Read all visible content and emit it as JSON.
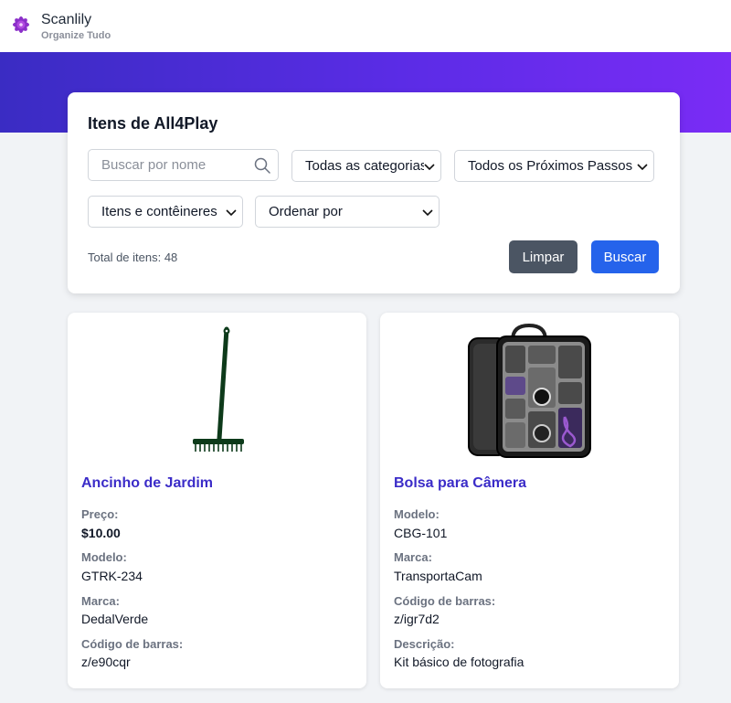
{
  "header": {
    "brand_name": "Scanlily",
    "tagline": "Organize Tudo"
  },
  "filters": {
    "title": "Itens de All4Play",
    "search_placeholder": "Buscar por nome",
    "category_select": "Todas as categorias",
    "next_steps_select": "Todos os Próximos Passos",
    "item_type_select": "Itens e contêineres",
    "sort_select": "Ordenar por",
    "total_label": "Total de itens: 48",
    "clear_label": "Limpar",
    "search_label": "Buscar"
  },
  "items": [
    {
      "title": "Ancinho de Jardim",
      "image_icon": "rake-icon",
      "fields": [
        {
          "label": "Preço:",
          "value": "$10.00"
        },
        {
          "label": "Modelo:",
          "value": "GTRK-234"
        },
        {
          "label": "Marca:",
          "value": "DedalVerde"
        },
        {
          "label": "Código de barras:",
          "value": "z/e90cqr"
        }
      ]
    },
    {
      "title": "Bolsa para Câmera",
      "image_icon": "camera-bag-icon",
      "fields": [
        {
          "label": "Modelo:",
          "value": "CBG-101"
        },
        {
          "label": "Marca:",
          "value": "TransportaCam"
        },
        {
          "label": "Código de barras:",
          "value": "z/igr7d2"
        },
        {
          "label": "Descrição:",
          "value": "Kit básico de fotografia"
        }
      ]
    }
  ],
  "colors": {
    "accent": "#3b2cc8",
    "primary_button": "#2563eb",
    "secondary_button": "#4b5563",
    "hero_start": "#3a2cc3",
    "hero_end": "#7a2cf5"
  }
}
